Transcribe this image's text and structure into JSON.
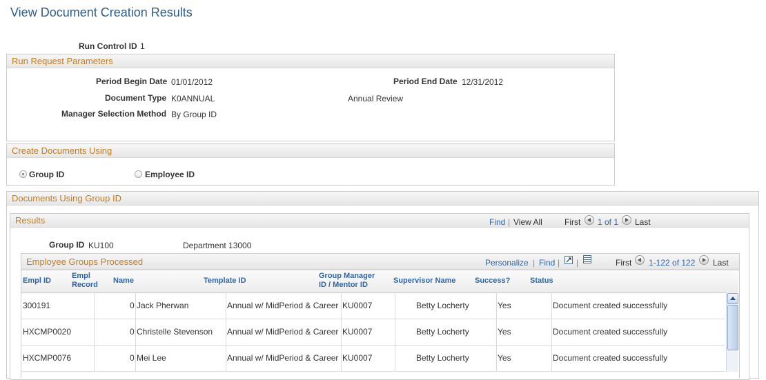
{
  "page": {
    "title": "View Document Creation Results"
  },
  "run_control": {
    "label": "Run Control ID",
    "value": "1"
  },
  "run_request": {
    "header": "Run Request Parameters",
    "period_begin_label": "Period Begin Date",
    "period_begin_value": "01/01/2012",
    "period_end_label": "Period End Date",
    "period_end_value": "12/31/2012",
    "doc_type_label": "Document Type",
    "doc_type_value": "K0ANNUAL",
    "doc_type_desc": "Annual Review",
    "mgr_method_label": "Manager Selection Method",
    "mgr_method_value": "By Group ID"
  },
  "create_using": {
    "header": "Create Documents Using",
    "option_group": "Group ID",
    "option_employee": "Employee ID",
    "selected": "Group ID"
  },
  "documents": {
    "header": "Documents Using Group ID"
  },
  "results": {
    "header": "Results",
    "find": "Find",
    "view_all": "View All",
    "first": "First",
    "range": "1 of 1",
    "last": "Last",
    "group_label": "Group ID",
    "group_value": "KU100",
    "department": "Department 13000"
  },
  "employee_groups": {
    "header": "Employee Groups Processed",
    "personalize": "Personalize",
    "find": "Find",
    "first": "First",
    "range": "1-122 of 122",
    "last": "Last",
    "columns": {
      "empl_id": "Empl ID",
      "empl_record_1": "Empl",
      "empl_record_2": "Record",
      "name": "Name",
      "template_id": "Template ID",
      "group_manager_1": "Group Manager",
      "group_manager_2": "ID / Mentor ID",
      "supervisor": "Supervisor Name",
      "success": "Success?",
      "status": "Status"
    },
    "rows": [
      {
        "empl_id": "300191",
        "record": "0",
        "name": "Jack Pherwan",
        "template": "Annual w/ MidPeriod & Career",
        "manager": "KU0007",
        "supervisor": "Betty Locherty",
        "success": "Yes",
        "status": "Document created successfully"
      },
      {
        "empl_id": "HXCMP0020",
        "record": "0",
        "name": "Christelle Stevenson",
        "template": "Annual w/ MidPeriod & Career",
        "manager": "KU0007",
        "supervisor": "Betty Locherty",
        "success": "Yes",
        "status": "Document created successfully"
      },
      {
        "empl_id": "HXCMP0076",
        "record": "0",
        "name": "Mei Lee",
        "template": "Annual w/ MidPeriod & Career",
        "manager": "KU0007",
        "supervisor": "Betty Locherty",
        "success": "Yes",
        "status": "Document created successfully"
      }
    ]
  },
  "icons": {
    "zoom": "zoom-grid-icon",
    "download": "download-excel-icon",
    "prev": "prev-arrow-icon",
    "next": "next-arrow-icon"
  },
  "colors": {
    "title": "#2d5d8b",
    "section_header": "#c47c1d",
    "link": "#2c65a8"
  }
}
